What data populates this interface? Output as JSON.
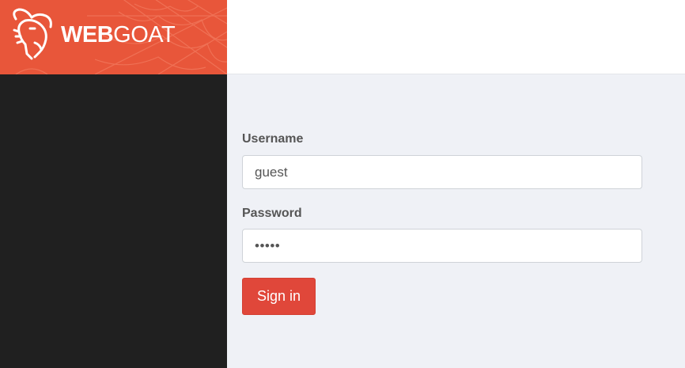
{
  "header": {
    "brand_bold": "WEB",
    "brand_light": "GOAT",
    "brand_color": "#e8563a",
    "logo_icon": "goat-head-icon"
  },
  "sidebar": {
    "background": "#202020"
  },
  "login": {
    "username_label": "Username",
    "username_value": "guest",
    "password_label": "Password",
    "password_value": "•••••",
    "signin_label": "Sign in",
    "signin_color": "#e0473a"
  }
}
